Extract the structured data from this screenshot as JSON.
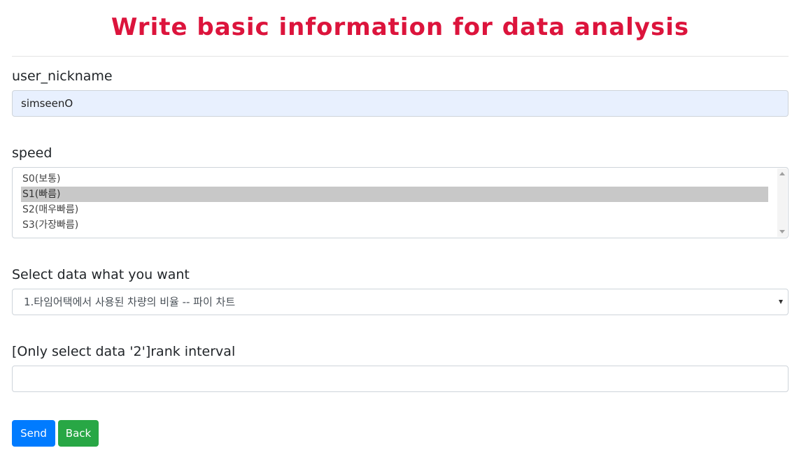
{
  "header": {
    "title": "Write basic information for data analysis"
  },
  "form": {
    "nickname": {
      "label": "user_nickname",
      "value": "simseenO"
    },
    "speed": {
      "label": "speed",
      "options": [
        "S0(보통)",
        "S1(빠름)",
        "S2(매우빠름)",
        "S3(가장빠름)"
      ],
      "selected": "S1(빠름)"
    },
    "data_select": {
      "label": "Select data what you want",
      "selected": "1.타임어택에서 사용된 차량의 비율 -- 파이 차트"
    },
    "rank_interval": {
      "label": "[Only select data '2']rank interval",
      "value": ""
    },
    "buttons": {
      "send": "Send",
      "back": "Back"
    }
  },
  "colors": {
    "title": "#dc143c",
    "send_button": "#007bff",
    "back_button": "#28a745",
    "autofill_background": "#e8f0fe",
    "selected_option": "#c8c8c8"
  }
}
